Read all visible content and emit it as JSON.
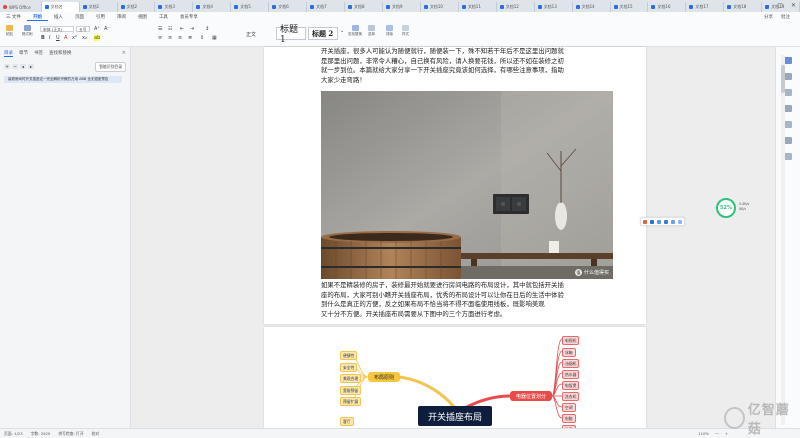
{
  "tabs": [
    "WPS Office",
    "文档名",
    "文档1",
    "文档2",
    "文档3",
    "文档4",
    "文档5",
    "文档6",
    "文档7",
    "文档8",
    "文档9",
    "文档10",
    "文档11",
    "文档12",
    "文档13",
    "文档14",
    "文档15",
    "文档16",
    "文档17",
    "文档18",
    "文档19"
  ],
  "menu": {
    "file": "三 文件",
    "items": [
      "开始",
      "插入",
      "页面",
      "引用",
      "审阅",
      "视图",
      "工具",
      "会员专享"
    ],
    "right": [
      "分享",
      "批注"
    ]
  },
  "ribbon": {
    "paste": "粘贴",
    "format_painter": "格式刷",
    "font_name": "宋体 (正文)",
    "font_size": "五号",
    "style_body": "正文",
    "style_h1": "标题 1",
    "style_h2": "标题 2",
    "find_replace": "查找替换",
    "select": "选择",
    "layout": "排版",
    "style_set": "样式"
  },
  "left_panel": {
    "tabs": [
      "目录",
      "章节",
      "书签",
      "查找和替换"
    ],
    "active_tab": 0,
    "close": "×",
    "smart_toc": "智能识别目录",
    "toc_item": "装修房间时开关插座这一完全解析宗教的万用 ABB 全无插座预告"
  },
  "document": {
    "para1": [
      "开关插座，很多人可能认为随便就行，随便装一下，殊不知若干年后不是这里出问题就",
      "是那里出问题，非常令人糟心，自己换有风险，请人换要花钱，所以还不如在装修之初",
      "就一步到位。本篇就给大家分享一下开关插座究竟该如何选择，有哪些注意事项，指助",
      "大家少走弯路！"
    ],
    "photo_watermark": "什么值得买",
    "para2": [
      "如果不是精装修的房子，装修最开始就要进行房间电路的布局设计，其中就包括开关插",
      "座的布局，大家可别小瞧开关插座布局，优秀的布局设计可以让你在日后的生活中体验",
      "到什么是真正的方便，反之如果布局不恰当将不得不面临使用线板，既影响美观",
      "又十分不方便。开关插座布局需要从下图中的三个方面进行考虑。"
    ]
  },
  "mindmap": {
    "center": "开关插座布局",
    "branch_left": "布局原则",
    "branch_right": "电器位置划分",
    "left_leaves": [
      "便捷性",
      "安全性",
      "美观合理",
      "宽裕预留",
      "预留扩展",
      "客厅"
    ],
    "right_leaves": [
      "电视机",
      "冰箱",
      "油烟机",
      "热水器",
      "电饭煲",
      "洗衣机",
      "空调",
      "电脑",
      "卧室"
    ]
  },
  "float_panel": {
    "speed_value": "52%",
    "upload": "5.4K/s",
    "download": "0K/s"
  },
  "status": {
    "left": [
      "页面: 1/23",
      "字数: 2920",
      "拼写检查: 打开",
      "校对"
    ],
    "right": [
      "110%",
      "一",
      "+"
    ]
  },
  "logo_text": "亿智蘑菇",
  "colors": {
    "accent": "#2b6de5",
    "mindmap_center": "#0f1e3c",
    "branch_left": "#f7c63d",
    "branch_right": "#e94b4b",
    "speed_ring": "#2fc27a"
  }
}
